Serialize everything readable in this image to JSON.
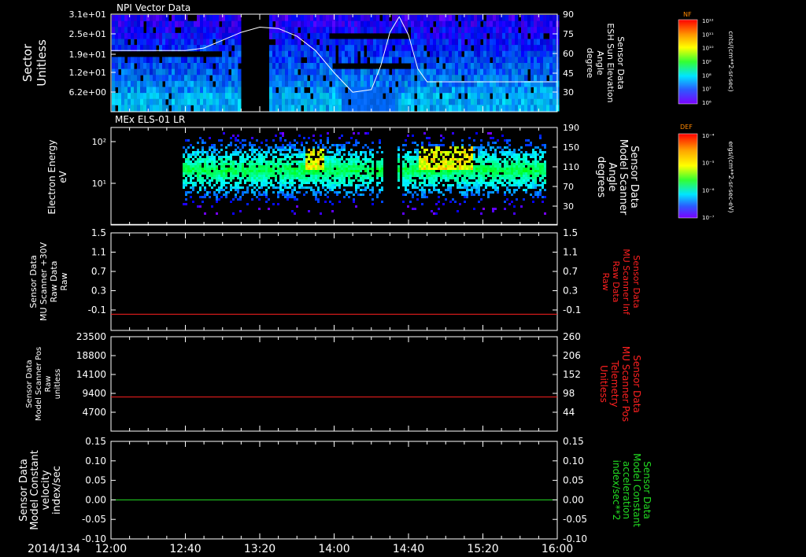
{
  "footer": {
    "date_label": "2014/134",
    "time_ticks": [
      "12:00",
      "12:40",
      "13:20",
      "14:00",
      "14:40",
      "15:20",
      "16:00"
    ]
  },
  "colors": {
    "white": "#ffffff",
    "red": "#ff2020",
    "green": "#22dd22",
    "frame": "#ffffff"
  },
  "colorbars": [
    {
      "id": "nf",
      "title": "NF",
      "units": "cnts/(cm**2-sr-sec)",
      "tick_labels": [
        "10¹²",
        "10¹¹",
        "10¹⁰",
        "10⁹",
        "10⁸",
        "10⁷",
        "10⁶"
      ]
    },
    {
      "id": "def",
      "title": "DEF",
      "units": "ergs/(cm**2-sr-sec-eV)",
      "tick_labels": [
        "10⁻⁴",
        "10⁻⁵",
        "10⁻⁶",
        "10⁻⁷"
      ]
    }
  ],
  "chart_data": [
    {
      "type": "heatmap",
      "title": "NPI Vector Data",
      "ylabel": [
        "Sector",
        "Unitless"
      ],
      "yticks": [
        "3.1e+01",
        "2.5e+01",
        "1.9e+01",
        "1.2e+01",
        "6.2e+00"
      ],
      "y2label": [
        "Sensor Data",
        "ESH Sun Elevation",
        "Angle",
        "degree"
      ],
      "y2ticks": [
        "90",
        "75",
        "60",
        "45",
        "30"
      ],
      "y2lim": [
        15,
        90
      ],
      "xlim": [
        "12:00",
        "16:00"
      ],
      "overlay_line": {
        "name": "ESH Sun Elevation Angle",
        "x": [
          "12:00",
          "12:40",
          "12:50",
          "13:00",
          "13:10",
          "13:20",
          "13:30",
          "13:40",
          "13:50",
          "14:00",
          "14:10",
          "14:20",
          "14:25",
          "14:30",
          "14:35",
          "14:40",
          "14:45",
          "14:50",
          "15:00",
          "15:20",
          "16:00"
        ],
        "y": [
          62,
          62,
          64,
          70,
          76,
          80,
          79,
          73,
          62,
          45,
          30,
          32,
          50,
          76,
          88,
          74,
          48,
          38,
          38,
          38,
          38
        ]
      }
    },
    {
      "type": "heatmap",
      "title": "MEx ELS-01 LR",
      "ylabel": [
        "Electron Energy",
        "eV"
      ],
      "yscale": "log",
      "yticks": [
        "10²",
        "10¹"
      ],
      "y2label": [
        "Sensor Data",
        "Model Scanner",
        "Angle",
        "degrees"
      ],
      "y2ticks": [
        "190",
        "150",
        "110",
        "70",
        "30"
      ],
      "y2lim": [
        10,
        190
      ],
      "overlay_line": {
        "name": "Model Scanner Angle",
        "x": [
          "12:00",
          "16:00"
        ],
        "y": [
          11,
          11
        ]
      }
    },
    {
      "type": "line",
      "ylabel": [
        "Sensor Data",
        "MU Scanner +30V",
        "Raw Data",
        "Raw"
      ],
      "yticks": [
        "1.5",
        "1.1",
        "0.7",
        "0.3",
        "-0.1"
      ],
      "ylim": [
        -0.3,
        1.5
      ],
      "y2label": [
        "Sensor Data",
        "MU Scanner Inf",
        "Raw Data",
        "Raw"
      ],
      "y2ticks": [
        "1.5",
        "1.1",
        "0.7",
        "0.3",
        "-0.1"
      ],
      "series": [
        {
          "x": [
            "12:00",
            "16:00"
          ],
          "values": [
            0.0,
            0.0
          ]
        }
      ]
    },
    {
      "type": "line",
      "ylabel": [
        "Sensor Data",
        "Model Scanner Pos",
        "Raw",
        "unitless"
      ],
      "yticks": [
        "23500",
        "18800",
        "14100",
        "9400",
        "4700"
      ],
      "ylim": [
        0,
        23500
      ],
      "y2label": [
        "Sensor Data",
        "MU Scanner Pos",
        "Telemetry",
        "Unitless"
      ],
      "y2ticks": [
        "260",
        "206",
        "152",
        "98",
        "44"
      ],
      "series": [
        {
          "x": [
            "12:00",
            "16:00"
          ],
          "values": [
            8500,
            8500
          ]
        }
      ]
    },
    {
      "type": "line",
      "ylabel": [
        "Sensor Data",
        "Model Constant",
        "velocity",
        "index/sec"
      ],
      "yticks": [
        "0.15",
        "0.10",
        "0.05",
        "0.00",
        "-0.05",
        "-0.10"
      ],
      "ylim": [
        -0.1,
        0.15
      ],
      "y2label": [
        "Sensor Data",
        "Model Constant",
        "acceleration",
        "index/sec**2"
      ],
      "y2ticks": [
        "0.15",
        "0.10",
        "0.05",
        "0.00",
        "-0.05",
        "-0.10"
      ],
      "series": [
        {
          "x": [
            "12:00",
            "16:00"
          ],
          "values": [
            0.0,
            0.0
          ]
        }
      ]
    }
  ]
}
